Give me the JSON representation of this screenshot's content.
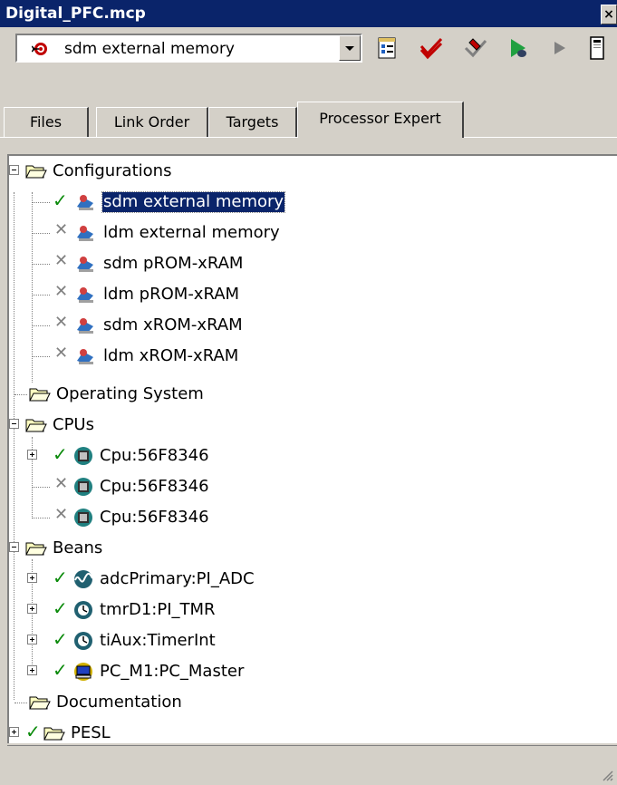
{
  "window": {
    "title": "Digital_PFC.mcp",
    "close_glyph": "×"
  },
  "toolbar": {
    "target_select": {
      "value": "sdm external memory",
      "icon": "target-bullseye-icon"
    },
    "buttons": [
      "settings-icon",
      "check-icon",
      "make-icon",
      "debug-icon",
      "run-icon",
      "window-icon"
    ]
  },
  "tabs": [
    {
      "label": "Files",
      "active": false
    },
    {
      "label": "Link Order",
      "active": false
    },
    {
      "label": "Targets",
      "active": false
    },
    {
      "label": "Processor Expert",
      "active": true
    }
  ],
  "tree": {
    "configurations": {
      "label": "Configurations",
      "items": [
        {
          "label": "sdm external memory",
          "state": "checked",
          "selected": true
        },
        {
          "label": "ldm external memory",
          "state": "unchecked"
        },
        {
          "label": "sdm pROM-xRAM",
          "state": "unchecked"
        },
        {
          "label": "ldm pROM-xRAM",
          "state": "unchecked"
        },
        {
          "label": "sdm xROM-xRAM",
          "state": "unchecked"
        },
        {
          "label": "ldm xROM-xRAM",
          "state": "unchecked"
        }
      ]
    },
    "operating_system": {
      "label": "Operating System"
    },
    "cpus": {
      "label": "CPUs",
      "items": [
        {
          "label": "Cpu:56F8346",
          "state": "checked",
          "expandable": true
        },
        {
          "label": "Cpu:56F8346",
          "state": "unchecked"
        },
        {
          "label": "Cpu:56F8346",
          "state": "unchecked"
        }
      ]
    },
    "beans": {
      "label": "Beans",
      "items": [
        {
          "label": "adcPrimary:PI_ADC",
          "state": "checked",
          "icon": "adc-bean-icon"
        },
        {
          "label": "tmrD1:PI_TMR",
          "state": "checked",
          "icon": "timer-bean-icon"
        },
        {
          "label": "tiAux:TimerInt",
          "state": "checked",
          "icon": "timer-bean-icon"
        },
        {
          "label": "PC_M1:PC_Master",
          "state": "checked",
          "icon": "pc-master-bean-icon"
        }
      ]
    },
    "documentation": {
      "label": "Documentation"
    },
    "pesl": {
      "label": "PESL",
      "state": "checked"
    }
  },
  "glyphs": {
    "check": "✓",
    "cross": "✕"
  }
}
